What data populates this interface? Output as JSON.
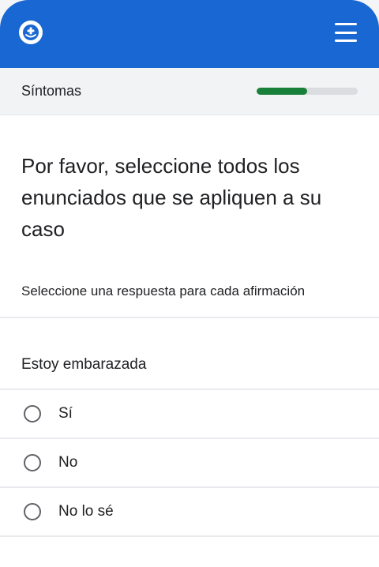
{
  "header": {
    "logo_icon": "plus-badge-icon",
    "menu_icon": "hamburger-menu-icon",
    "color": "#1967d2"
  },
  "progress": {
    "section_label": "Síntomas",
    "value_fraction": 0.5,
    "fill_color": "#188038"
  },
  "question": {
    "text": "Por favor, seleccione todos los enunciados que se apliquen a su caso",
    "instruction": "Seleccione una respuesta para cada afirmación"
  },
  "statement": {
    "text": "Estoy embarazada",
    "options": [
      {
        "label": "Sí"
      },
      {
        "label": "No"
      },
      {
        "label": "No lo sé"
      }
    ]
  }
}
